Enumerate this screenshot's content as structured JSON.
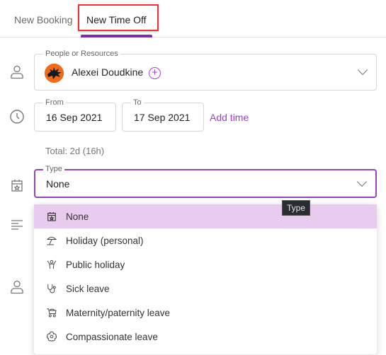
{
  "tabs": [
    {
      "label": "New Booking",
      "active": false
    },
    {
      "label": "New Time Off",
      "active": true
    }
  ],
  "colors": {
    "accent": "#7b2fa3",
    "link": "#9b3fc3",
    "selected_option_bg": "#e8cbef",
    "highlight_box": "#e0353b"
  },
  "people": {
    "label": "People or Resources",
    "value": "Alexei Doudkine",
    "add_icon": "plus-circle-icon",
    "row_icon": "person-icon"
  },
  "dates": {
    "row_icon": "clock-icon",
    "from_label": "From",
    "from_value": "16 Sep 2021",
    "to_label": "To",
    "to_value": "17 Sep 2021",
    "add_time_label": "Add time",
    "total": "Total: 2d (16h)"
  },
  "type": {
    "row_icon": "calendar-star-icon",
    "label": "Type",
    "value": "None",
    "tooltip": "Type",
    "options": [
      {
        "label": "None",
        "icon": "calendar-star-icon",
        "selected": true
      },
      {
        "label": "Holiday (personal)",
        "icon": "beach-umbrella-icon",
        "selected": false
      },
      {
        "label": "Public holiday",
        "icon": "celebrating-person-icon",
        "selected": false
      },
      {
        "label": "Sick leave",
        "icon": "stethoscope-icon",
        "selected": false
      },
      {
        "label": "Maternity/paternity leave",
        "icon": "pram-icon",
        "selected": false
      },
      {
        "label": "Compassionate leave",
        "icon": "flower-icon",
        "selected": false
      }
    ]
  },
  "side_icons": [
    "notes-icon",
    "person-icon"
  ]
}
